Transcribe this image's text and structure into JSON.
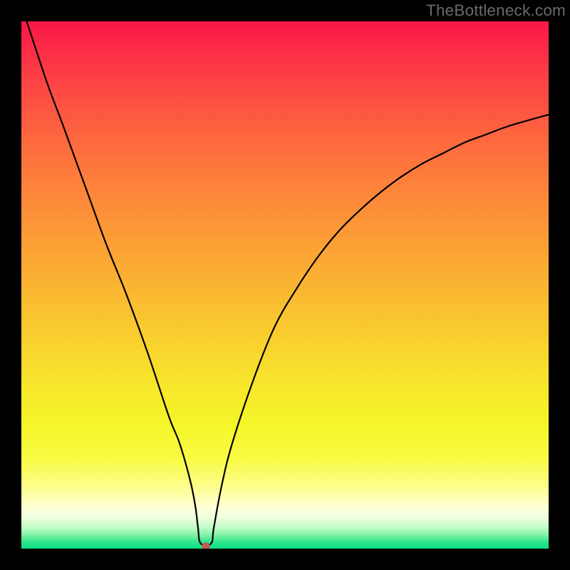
{
  "watermark": "TheBottleneck.com",
  "chart_data": {
    "type": "line",
    "title": "",
    "xlabel": "",
    "ylabel": "",
    "xlim": [
      0,
      100
    ],
    "ylim": [
      0,
      100
    ],
    "grid": false,
    "legend": false,
    "marker": {
      "x": 35,
      "y": 0,
      "color": "#c75a52"
    },
    "curve": {
      "x": [
        0,
        2,
        5,
        8,
        12,
        16,
        20,
        24,
        28,
        30,
        32,
        33,
        33.5,
        34,
        36,
        36.5,
        38,
        40,
        44,
        48,
        52,
        56,
        60,
        64,
        68,
        72,
        76,
        80,
        84,
        88,
        92,
        96,
        100
      ],
      "y": [
        103,
        97,
        88,
        80,
        69,
        58,
        48,
        37,
        25,
        20,
        13,
        8,
        4,
        1,
        1,
        4,
        12,
        20,
        32,
        42,
        49,
        55,
        60,
        64,
        67.5,
        70.5,
        73,
        75,
        77,
        78.5,
        80,
        81.2,
        82.3
      ]
    },
    "background_gradient": {
      "type": "vertical",
      "stops": [
        {
          "pos": 0,
          "color": "#fa1648"
        },
        {
          "pos": 0.5,
          "color": "#fbc932"
        },
        {
          "pos": 0.78,
          "color": "#f6f52a"
        },
        {
          "pos": 0.92,
          "color": "#ffffd6"
        },
        {
          "pos": 1.0,
          "color": "#0adf83"
        }
      ]
    }
  }
}
